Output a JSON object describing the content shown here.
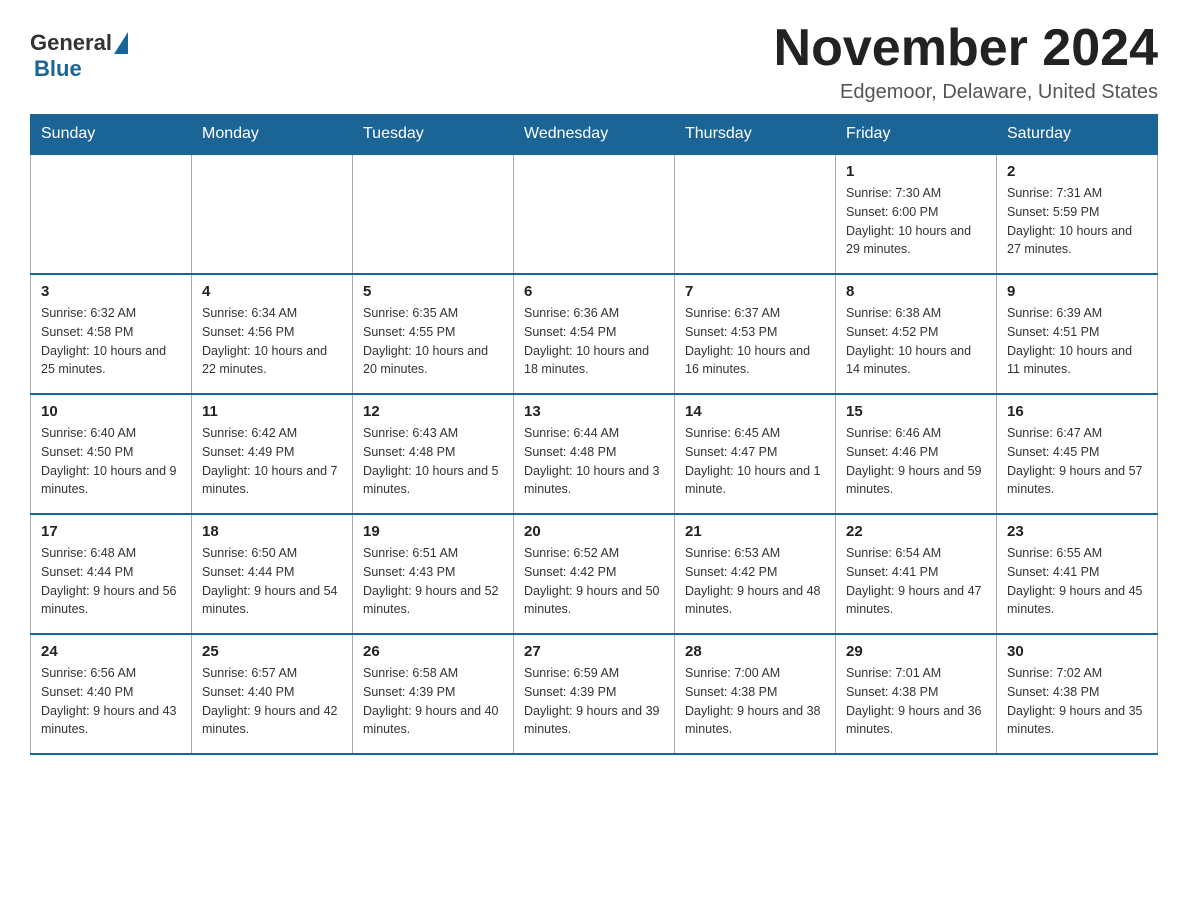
{
  "logo": {
    "general_text": "General",
    "blue_text": "Blue"
  },
  "title": "November 2024",
  "subtitle": "Edgemoor, Delaware, United States",
  "weekdays": [
    "Sunday",
    "Monday",
    "Tuesday",
    "Wednesday",
    "Thursday",
    "Friday",
    "Saturday"
  ],
  "weeks": [
    [
      {
        "day": "",
        "info": ""
      },
      {
        "day": "",
        "info": ""
      },
      {
        "day": "",
        "info": ""
      },
      {
        "day": "",
        "info": ""
      },
      {
        "day": "",
        "info": ""
      },
      {
        "day": "1",
        "info": "Sunrise: 7:30 AM\nSunset: 6:00 PM\nDaylight: 10 hours and 29 minutes."
      },
      {
        "day": "2",
        "info": "Sunrise: 7:31 AM\nSunset: 5:59 PM\nDaylight: 10 hours and 27 minutes."
      }
    ],
    [
      {
        "day": "3",
        "info": "Sunrise: 6:32 AM\nSunset: 4:58 PM\nDaylight: 10 hours and 25 minutes."
      },
      {
        "day": "4",
        "info": "Sunrise: 6:34 AM\nSunset: 4:56 PM\nDaylight: 10 hours and 22 minutes."
      },
      {
        "day": "5",
        "info": "Sunrise: 6:35 AM\nSunset: 4:55 PM\nDaylight: 10 hours and 20 minutes."
      },
      {
        "day": "6",
        "info": "Sunrise: 6:36 AM\nSunset: 4:54 PM\nDaylight: 10 hours and 18 minutes."
      },
      {
        "day": "7",
        "info": "Sunrise: 6:37 AM\nSunset: 4:53 PM\nDaylight: 10 hours and 16 minutes."
      },
      {
        "day": "8",
        "info": "Sunrise: 6:38 AM\nSunset: 4:52 PM\nDaylight: 10 hours and 14 minutes."
      },
      {
        "day": "9",
        "info": "Sunrise: 6:39 AM\nSunset: 4:51 PM\nDaylight: 10 hours and 11 minutes."
      }
    ],
    [
      {
        "day": "10",
        "info": "Sunrise: 6:40 AM\nSunset: 4:50 PM\nDaylight: 10 hours and 9 minutes."
      },
      {
        "day": "11",
        "info": "Sunrise: 6:42 AM\nSunset: 4:49 PM\nDaylight: 10 hours and 7 minutes."
      },
      {
        "day": "12",
        "info": "Sunrise: 6:43 AM\nSunset: 4:48 PM\nDaylight: 10 hours and 5 minutes."
      },
      {
        "day": "13",
        "info": "Sunrise: 6:44 AM\nSunset: 4:48 PM\nDaylight: 10 hours and 3 minutes."
      },
      {
        "day": "14",
        "info": "Sunrise: 6:45 AM\nSunset: 4:47 PM\nDaylight: 10 hours and 1 minute."
      },
      {
        "day": "15",
        "info": "Sunrise: 6:46 AM\nSunset: 4:46 PM\nDaylight: 9 hours and 59 minutes."
      },
      {
        "day": "16",
        "info": "Sunrise: 6:47 AM\nSunset: 4:45 PM\nDaylight: 9 hours and 57 minutes."
      }
    ],
    [
      {
        "day": "17",
        "info": "Sunrise: 6:48 AM\nSunset: 4:44 PM\nDaylight: 9 hours and 56 minutes."
      },
      {
        "day": "18",
        "info": "Sunrise: 6:50 AM\nSunset: 4:44 PM\nDaylight: 9 hours and 54 minutes."
      },
      {
        "day": "19",
        "info": "Sunrise: 6:51 AM\nSunset: 4:43 PM\nDaylight: 9 hours and 52 minutes."
      },
      {
        "day": "20",
        "info": "Sunrise: 6:52 AM\nSunset: 4:42 PM\nDaylight: 9 hours and 50 minutes."
      },
      {
        "day": "21",
        "info": "Sunrise: 6:53 AM\nSunset: 4:42 PM\nDaylight: 9 hours and 48 minutes."
      },
      {
        "day": "22",
        "info": "Sunrise: 6:54 AM\nSunset: 4:41 PM\nDaylight: 9 hours and 47 minutes."
      },
      {
        "day": "23",
        "info": "Sunrise: 6:55 AM\nSunset: 4:41 PM\nDaylight: 9 hours and 45 minutes."
      }
    ],
    [
      {
        "day": "24",
        "info": "Sunrise: 6:56 AM\nSunset: 4:40 PM\nDaylight: 9 hours and 43 minutes."
      },
      {
        "day": "25",
        "info": "Sunrise: 6:57 AM\nSunset: 4:40 PM\nDaylight: 9 hours and 42 minutes."
      },
      {
        "day": "26",
        "info": "Sunrise: 6:58 AM\nSunset: 4:39 PM\nDaylight: 9 hours and 40 minutes."
      },
      {
        "day": "27",
        "info": "Sunrise: 6:59 AM\nSunset: 4:39 PM\nDaylight: 9 hours and 39 minutes."
      },
      {
        "day": "28",
        "info": "Sunrise: 7:00 AM\nSunset: 4:38 PM\nDaylight: 9 hours and 38 minutes."
      },
      {
        "day": "29",
        "info": "Sunrise: 7:01 AM\nSunset: 4:38 PM\nDaylight: 9 hours and 36 minutes."
      },
      {
        "day": "30",
        "info": "Sunrise: 7:02 AM\nSunset: 4:38 PM\nDaylight: 9 hours and 35 minutes."
      }
    ]
  ]
}
